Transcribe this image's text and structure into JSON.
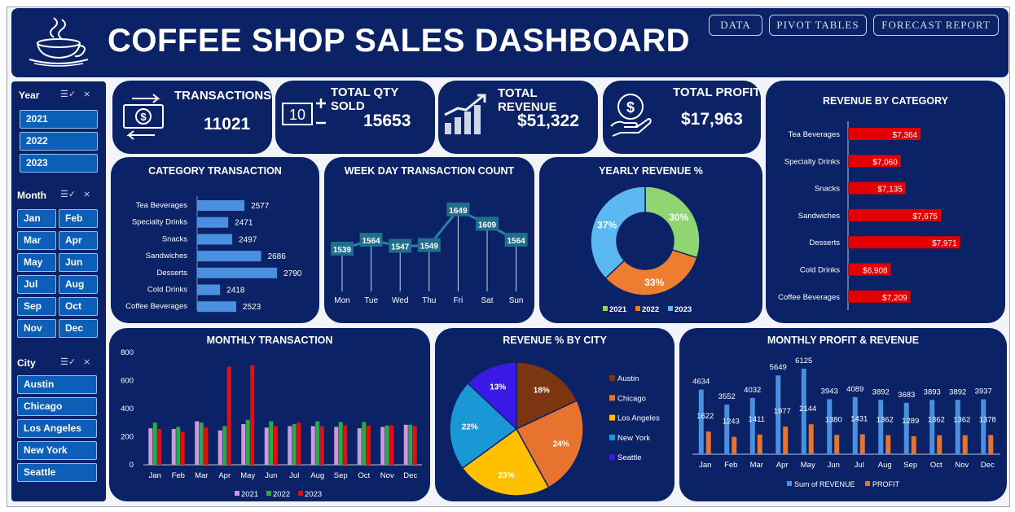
{
  "header": {
    "title": "COFFEE SHOP SALES DASHBOARD",
    "buttons": [
      "DATA",
      "PIVOT TABLES",
      "FORECAST REPORT"
    ]
  },
  "slicers": {
    "year": {
      "label": "Year",
      "items": [
        "2021",
        "2022",
        "2023"
      ]
    },
    "month": {
      "label": "Month",
      "items": [
        "Jan",
        "Feb",
        "Mar",
        "Apr",
        "May",
        "Jun",
        "Jul",
        "Aug",
        "Sep",
        "Oct",
        "Nov",
        "Dec"
      ]
    },
    "city": {
      "label": "City",
      "items": [
        "Austin",
        "Chicago",
        "Los Angeles",
        "New York",
        "Seattle"
      ]
    }
  },
  "kpis": {
    "transactions": {
      "label": "TRANSACTIONS",
      "value": "11021",
      "icon": "money-exchange-icon"
    },
    "qty": {
      "label": "TOTAL QTY SOLD",
      "value": "15653",
      "icon": "quantity-icon"
    },
    "revenue": {
      "label": "TOTAL REVENUE",
      "value": "$51,322",
      "icon": "growth-bars-icon"
    },
    "profit": {
      "label": "TOTAL PROFIT",
      "value": "$17,963",
      "icon": "dollar-hand-icon"
    }
  },
  "colors": {
    "panel": "#0b2266",
    "bar_blue": "#4a8fe0",
    "bar_red": "#e40000",
    "y2021": "#cc99dd",
    "y2022": "#2ea84b",
    "y2023": "#e80c0c"
  },
  "chart_data": [
    {
      "id": "category_transaction",
      "type": "bar",
      "title": "CATEGORY TRANSACTION",
      "categories": [
        "Tea Beverages",
        "Specialty Drinks",
        "Snacks",
        "Sandwiches",
        "Desserts",
        "Cold Drinks",
        "Coffee Beverages"
      ],
      "values": [
        2577,
        2471,
        2497,
        2686,
        2790,
        2418,
        2523
      ]
    },
    {
      "id": "weekday_transactions",
      "type": "line",
      "title": "WEEK DAY TRANSACTION COUNT",
      "categories": [
        "Mon",
        "Tue",
        "Wed",
        "Thu",
        "Fri",
        "Sat",
        "Sun"
      ],
      "values": [
        1539,
        1564,
        1547,
        1549,
        1649,
        1609,
        1564
      ]
    },
    {
      "id": "yearly_revenue",
      "type": "pie",
      "title": "YEARLY REVENUE %",
      "labels": [
        "2021",
        "2022",
        "2023"
      ],
      "values": [
        30,
        33,
        37
      ],
      "colors": [
        "#8fd672",
        "#ed7d31",
        "#5bb8f0"
      ]
    },
    {
      "id": "revenue_by_category",
      "type": "bar",
      "title": "REVENUE BY CATEGORY",
      "categories": [
        "Tea Beverages",
        "Specialty Drinks",
        "Snacks",
        "Sandwiches",
        "Desserts",
        "Cold Drinks",
        "Coffee Beverages"
      ],
      "values": [
        7364,
        7060,
        7135,
        7675,
        7971,
        6908,
        7209
      ],
      "labels": [
        "$7,364",
        "$7,060",
        "$7,135",
        "$7,675",
        "$7,971",
        "$6,908",
        "$7,209"
      ]
    },
    {
      "id": "monthly_transaction",
      "type": "bar",
      "title": "MONTHLY TRANSACTION",
      "categories": [
        "Jan",
        "Feb",
        "Mar",
        "Apr",
        "May",
        "Jun",
        "Jul",
        "Aug",
        "Sep",
        "Oct",
        "Nov",
        "Dec"
      ],
      "ylim": [
        0,
        800
      ],
      "yticks": [
        0,
        200,
        400,
        600,
        800
      ],
      "series": [
        {
          "name": "2021",
          "values": [
            260,
            255,
            310,
            245,
            290,
            265,
            275,
            275,
            270,
            260,
            270,
            285
          ]
        },
        {
          "name": "2022",
          "values": [
            300,
            270,
            300,
            275,
            320,
            310,
            290,
            310,
            305,
            305,
            280,
            285
          ]
        },
        {
          "name": "2023",
          "values": [
            255,
            235,
            265,
            700,
            710,
            275,
            300,
            275,
            280,
            280,
            280,
            275
          ]
        }
      ]
    },
    {
      "id": "revenue_by_city",
      "type": "pie",
      "title": "REVENUE % BY CITY",
      "labels": [
        "Austin",
        "Chicago",
        "Los Angeles",
        "New York",
        "Seattle"
      ],
      "values": [
        18,
        24,
        23,
        22,
        13
      ],
      "colors": [
        "#7b3510",
        "#e8732e",
        "#ffc000",
        "#1a98d6",
        "#3a1ae6"
      ]
    },
    {
      "id": "monthly_profit_revenue",
      "type": "bar",
      "title": "MONTHLY PROFIT & REVENUE",
      "categories": [
        "Jan",
        "Feb",
        "Mar",
        "Apr",
        "May",
        "Jun",
        "Jul",
        "Aug",
        "Sep",
        "Oct",
        "Nov",
        "Dec"
      ],
      "series": [
        {
          "name": "Sum of REVENUE",
          "values": [
            4634,
            3552,
            4032,
            5649,
            6125,
            3943,
            4089,
            3892,
            3683,
            3893,
            3892,
            3937
          ]
        },
        {
          "name": "PROFIT",
          "values": [
            1622,
            1243,
            1411,
            1977,
            2144,
            1380,
            1431,
            1362,
            1289,
            1362,
            1362,
            1378
          ]
        }
      ]
    }
  ]
}
